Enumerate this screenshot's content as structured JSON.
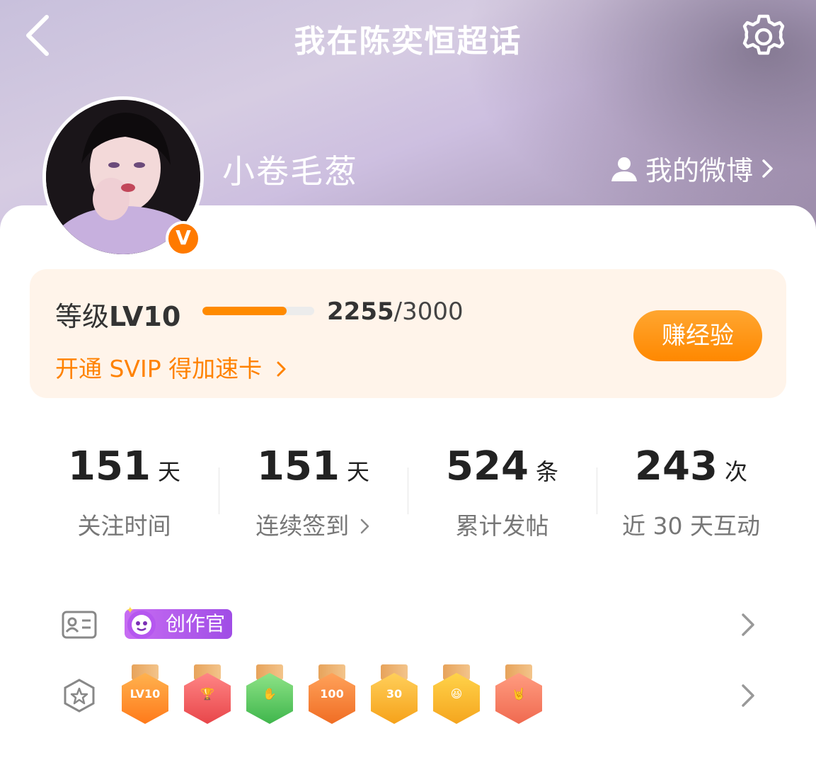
{
  "nav": {
    "title": "我在陈奕恒超话"
  },
  "profile": {
    "username": "小卷毛葱",
    "verified_badge": "V",
    "my_weibo_label": "我的微博"
  },
  "level": {
    "label_prefix": "等级",
    "label_level": "LV10",
    "current": "2255",
    "max": "/3000",
    "progress_fraction": 0.7517,
    "svip_link": "开通 SVIP 得加速卡",
    "earn_button": "赚经验"
  },
  "stats": [
    {
      "value": "151",
      "unit": "天",
      "label": "关注时间"
    },
    {
      "value": "151",
      "unit": "天",
      "label": "连续签到"
    },
    {
      "value": "524",
      "unit": "条",
      "label": "累计发帖"
    },
    {
      "value": "243",
      "unit": "次",
      "label": "近 30 天互动"
    }
  ],
  "badges": {
    "creator_tag": "创作官",
    "medals": [
      {
        "icon": "lv10-medal-icon",
        "glyph": "LV10"
      },
      {
        "icon": "trophy-medal-icon",
        "glyph": "🏆"
      },
      {
        "icon": "hand-medal-icon",
        "glyph": "✋"
      },
      {
        "icon": "100-days-medal-icon",
        "glyph": "100"
      },
      {
        "icon": "30-days-medal-icon",
        "glyph": "30"
      },
      {
        "icon": "cheer-medal-icon",
        "glyph": "😆"
      },
      {
        "icon": "rock-hand-medal-icon",
        "glyph": "🤘"
      }
    ]
  },
  "colors": {
    "accent": "#ff8200",
    "level_bg": "#fff4ea",
    "creator_tag": "#b45bec"
  }
}
